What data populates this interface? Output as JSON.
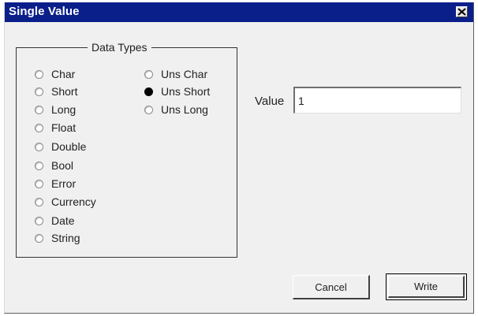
{
  "window": {
    "title": "Single Value"
  },
  "data_types": {
    "group_label": "Data Types",
    "options": [
      {
        "label": "Char",
        "checked": false
      },
      {
        "label": "Short",
        "checked": false
      },
      {
        "label": "Long",
        "checked": false
      },
      {
        "label": "Float",
        "checked": false
      },
      {
        "label": "Double",
        "checked": false
      },
      {
        "label": "Bool",
        "checked": false
      },
      {
        "label": "Error",
        "checked": false
      },
      {
        "label": "Currency",
        "checked": false
      },
      {
        "label": "Date",
        "checked": false
      },
      {
        "label": "String",
        "checked": false
      },
      {
        "label": "Uns Char",
        "checked": false
      },
      {
        "label": "Uns Short",
        "checked": true
      },
      {
        "label": "Uns Long",
        "checked": false
      }
    ]
  },
  "value_field": {
    "label": "Value",
    "value": "1"
  },
  "buttons": {
    "cancel": "Cancel",
    "write": "Write"
  },
  "colors": {
    "titlebar": "#0b1f8a",
    "dialog_bg": "#f0f0f0"
  }
}
